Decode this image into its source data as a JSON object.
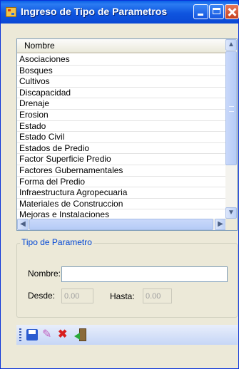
{
  "window": {
    "title": "Ingreso de Tipo de Parametros",
    "controls": [
      "minimize-icon",
      "maximize-icon",
      "close-icon"
    ]
  },
  "list": {
    "column_header": "Nombre",
    "rows": [
      "Asociaciones",
      "Bosques",
      "Cultivos",
      "Discapacidad",
      "Drenaje",
      "Erosion",
      "Estado",
      "Estado Civil",
      "Estados de Predio",
      "Factor Superficie Predio",
      "Factores Gubernamentales",
      "Forma del Predio",
      "Infraestructura Agropecuaria",
      "Materiales de Construccion",
      "Mejoras e Instalaciones"
    ]
  },
  "group": {
    "title": "Tipo de Parametro",
    "nombre_label": "Nombre:",
    "nombre_value": "",
    "desde_label": "Desde:",
    "desde_value": "0.00",
    "hasta_label": "Hasta:",
    "hasta_value": "0.00"
  },
  "toolbar": {
    "icons": [
      "save-icon",
      "edit-icon",
      "delete-icon",
      "exit-icon"
    ]
  },
  "colors": {
    "title_bar": "#0a5fe6",
    "window_bg": "#ece9d8",
    "group_title": "#0046d5",
    "close_button": "#c5401e"
  }
}
